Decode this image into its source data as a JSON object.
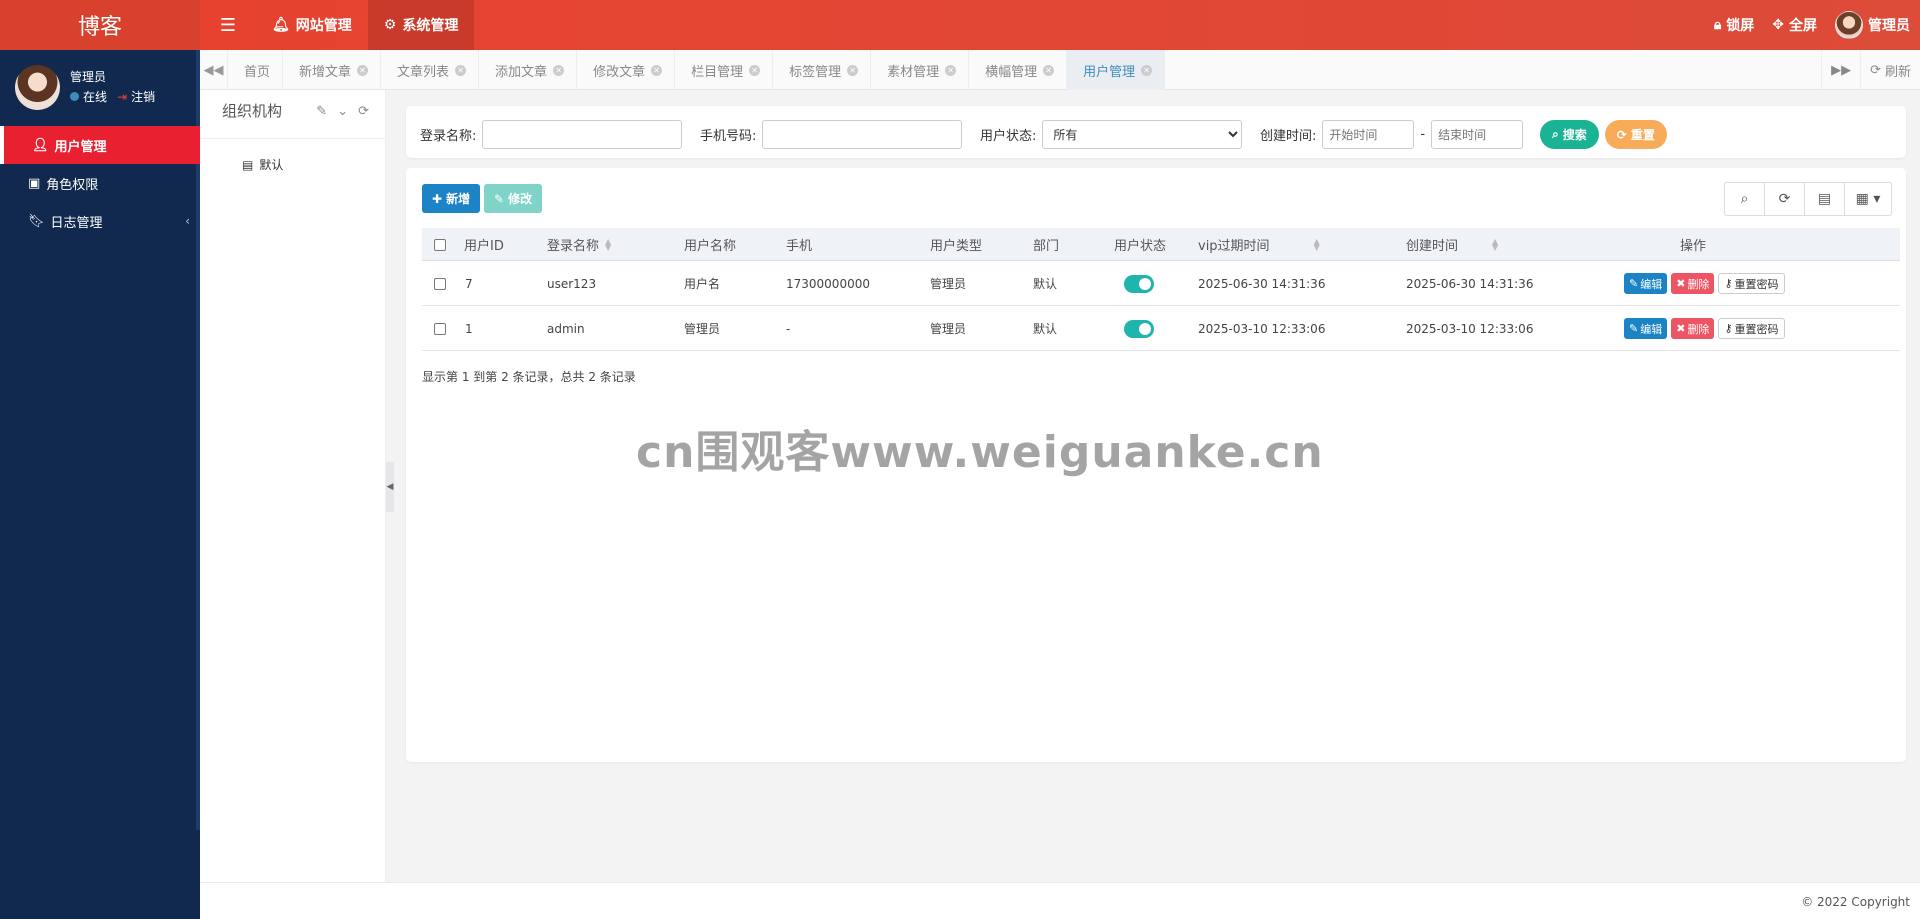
{
  "header": {
    "brand": "博客",
    "nav": [
      {
        "label": "网站管理",
        "icon": "bell-icon"
      },
      {
        "label": "系统管理",
        "icon": "gear-icon"
      }
    ],
    "right": {
      "lock": "锁屏",
      "fullscreen": "全屏",
      "user": "管理员"
    }
  },
  "sidebar": {
    "user": {
      "name": "管理员",
      "online": "在线",
      "logout": "注销"
    },
    "items": [
      {
        "label": "用户管理",
        "icon": "user-icon",
        "active": true
      },
      {
        "label": "角色权限",
        "icon": "id-card-icon"
      },
      {
        "label": "日志管理",
        "icon": "bookmark-icon"
      }
    ]
  },
  "tabs": {
    "items": [
      "首页",
      "新增文章",
      "文章列表",
      "添加文章",
      "修改文章",
      "栏目管理",
      "标签管理",
      "素材管理",
      "横幅管理",
      "用户管理"
    ],
    "active": "用户管理",
    "refresh": "刷新"
  },
  "org": {
    "title": "组织机构",
    "node": "默认"
  },
  "search": {
    "login_label": "登录名称:",
    "phone_label": "手机号码:",
    "status_label": "用户状态:",
    "status_value": "所有",
    "created_label": "创建时间:",
    "start_placeholder": "开始时间",
    "end_placeholder": "结束时间",
    "range_sep": "-",
    "search_btn": "搜索",
    "reset_btn": "重置"
  },
  "toolbar": {
    "add": "新增",
    "edit": "修改"
  },
  "table": {
    "columns": [
      "用户ID",
      "登录名称",
      "用户名称",
      "手机",
      "用户类型",
      "部门",
      "用户状态",
      "vip过期时间",
      "创建时间",
      "操作"
    ],
    "rows": [
      {
        "id": "7",
        "login": "user123",
        "name": "用户名",
        "phone": "17300000000",
        "type": "管理员",
        "dept": "默认",
        "status": true,
        "vip": "2025-06-30 14:31:36",
        "created": "2025-06-30 14:31:36"
      },
      {
        "id": "1",
        "login": "admin",
        "name": "管理员",
        "phone": "-",
        "type": "管理员",
        "dept": "默认",
        "status": true,
        "vip": "2025-03-10 12:33:06",
        "created": "2025-03-10 12:33:06"
      }
    ],
    "ops": {
      "edit": "编辑",
      "delete": "删除",
      "reset": "重置密码"
    },
    "page_info": "显示第 1 到第 2 条记录，总共 2 条记录"
  },
  "watermark": "cn围观客www.weiguanke.cn",
  "footer": "© 2022 Copyright",
  "colors": {
    "header": "#dd4b39",
    "sidebar": "#12294f",
    "active_menu": "#e8202f",
    "primary": "#1c84c6",
    "success": "#1ab394",
    "warning": "#f8ac59",
    "danger": "#ed5565"
  }
}
